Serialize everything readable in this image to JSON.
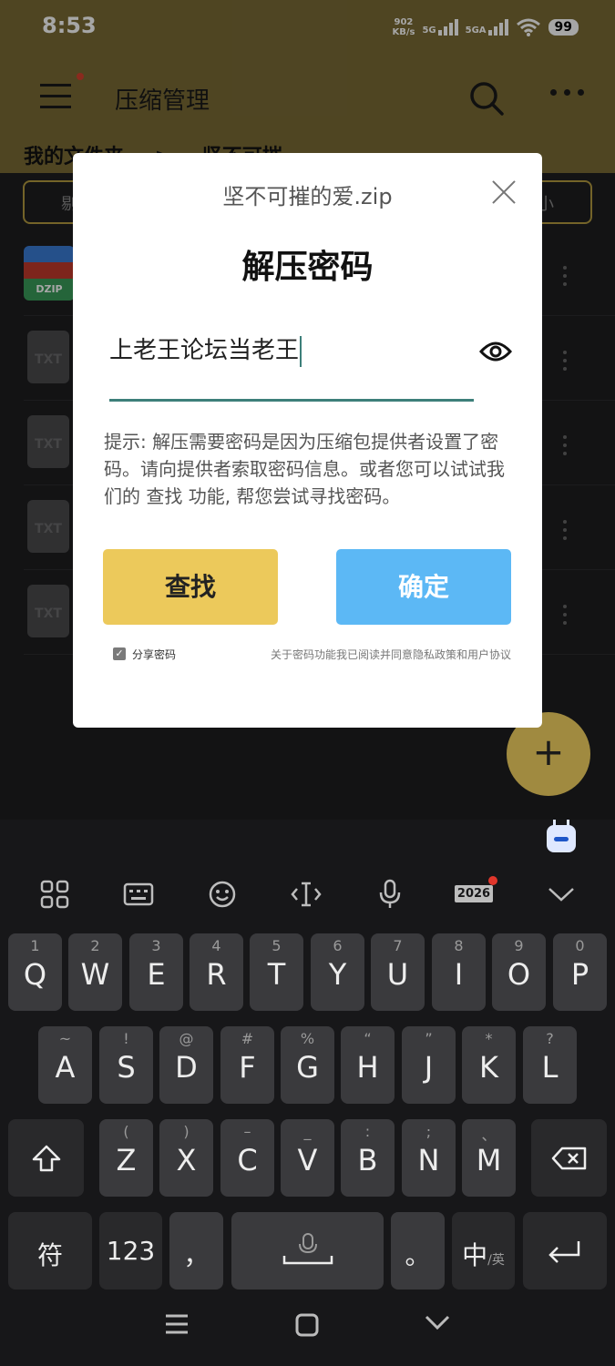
{
  "status": {
    "time": "8:53",
    "net_speed_value": "902",
    "net_speed_unit": "KB/s",
    "sim1": "5G",
    "sim2": "5GA",
    "battery": "99"
  },
  "app": {
    "title": "压缩管理",
    "breadcrumb_root": "我的文件夹",
    "breadcrumb_sep": ">",
    "breadcrumb_current": "坚不可摧",
    "toolbar_left_partial": "剔",
    "toolbar_right_partial": "小",
    "files": [
      {
        "type": "zip",
        "badge": "DZIP"
      },
      {
        "type": "txt",
        "badge": "TXT"
      },
      {
        "type": "txt",
        "badge": "TXT"
      },
      {
        "type": "txt",
        "badge": "TXT"
      },
      {
        "type": "txt",
        "badge": "TXT"
      }
    ],
    "fab_label": "+"
  },
  "dialog": {
    "filename": "坚不可摧的爱.zip",
    "title": "解压密码",
    "password_value": "上老王论坛当老王",
    "hint": "提示: 解压需要密码是因为压缩包提供者设置了密码。请向提供者索取密码信息。或者您可以试试我们的 查找 功能, 帮您尝试寻找密码。",
    "find_button": "查找",
    "ok_button": "确定",
    "share_checked": true,
    "share_label": "分享密码",
    "policy_text": "关于密码功能我已阅读并同意隐私政策和用户协议"
  },
  "keyboard": {
    "toolbar": {
      "apps": "88",
      "kbd": "▦",
      "emoji": "☺",
      "cursor": "‹I›",
      "mic": "🎙",
      "year": "2026",
      "collapse": "⌄"
    },
    "row1": [
      {
        "main": "Q",
        "sub": "1"
      },
      {
        "main": "W",
        "sub": "2"
      },
      {
        "main": "E",
        "sub": "3"
      },
      {
        "main": "R",
        "sub": "4"
      },
      {
        "main": "T",
        "sub": "5"
      },
      {
        "main": "Y",
        "sub": "6"
      },
      {
        "main": "U",
        "sub": "7"
      },
      {
        "main": "I",
        "sub": "8"
      },
      {
        "main": "O",
        "sub": "9"
      },
      {
        "main": "P",
        "sub": "0"
      }
    ],
    "row2": [
      {
        "main": "A",
        "sub": "~"
      },
      {
        "main": "S",
        "sub": "!"
      },
      {
        "main": "D",
        "sub": "@"
      },
      {
        "main": "F",
        "sub": "#"
      },
      {
        "main": "G",
        "sub": "%"
      },
      {
        "main": "H",
        "sub": "“"
      },
      {
        "main": "J",
        "sub": "”"
      },
      {
        "main": "K",
        "sub": "*"
      },
      {
        "main": "L",
        "sub": "?"
      }
    ],
    "row3": [
      {
        "main": "Z",
        "sub": "("
      },
      {
        "main": "X",
        "sub": ")"
      },
      {
        "main": "C",
        "sub": "–"
      },
      {
        "main": "V",
        "sub": "_"
      },
      {
        "main": "B",
        "sub": ":"
      },
      {
        "main": "N",
        "sub": ";"
      },
      {
        "main": "M",
        "sub": "、"
      }
    ],
    "shift": "⇧",
    "backspace": "⌫",
    "symbols": "符",
    "numbers": "123",
    "comma": "，",
    "period": "。",
    "lang_main": "中",
    "lang_sub": "/英",
    "enter": "↵"
  },
  "nav": {
    "menu": "☰",
    "home": "▢",
    "back": "⌵"
  }
}
